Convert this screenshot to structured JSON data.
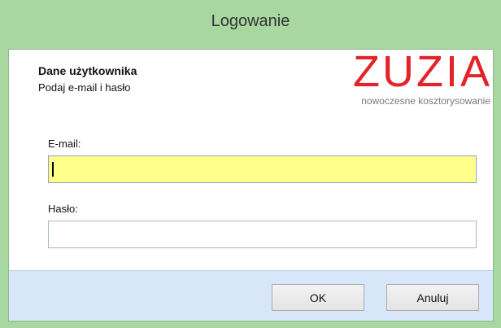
{
  "window": {
    "title": "Logowanie"
  },
  "header": {
    "title": "Dane użytkownika",
    "subtitle": "Podaj e-mail i hasło"
  },
  "logo": {
    "wordmark": "ZUZIA",
    "tagline": "nowoczesne kosztorysowanie",
    "color": "#e3242b"
  },
  "form": {
    "email_label": "E-mail:",
    "email_value": "",
    "password_label": "Hasło:",
    "password_value": ""
  },
  "buttons": {
    "ok_label": "OK",
    "cancel_label": "Anuluj"
  },
  "colors": {
    "titlebar": "#a9d7a0",
    "focused_field": "#ffff8c",
    "footer": "#d7e6f8"
  }
}
